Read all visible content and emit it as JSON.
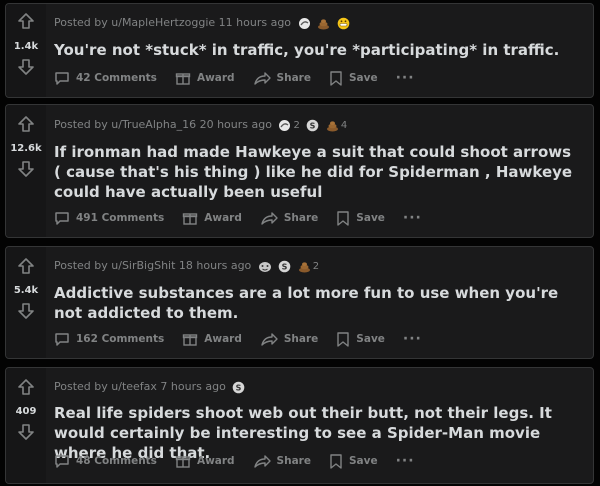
{
  "colors": {
    "background": "#030303",
    "card": "#1a1a1b",
    "card_border": "#343536",
    "text": "#d7dadc",
    "muted": "#818384"
  },
  "posts": [
    {
      "score": "1.4k",
      "posted_by_prefix": "Posted by ",
      "author": "u/MapleHertzoggie",
      "time": "11 hours ago",
      "awards": [
        {
          "icon": "rocket-like-award-icon",
          "count": ""
        },
        {
          "icon": "poop-award-icon",
          "count": ""
        },
        {
          "icon": "grinning-face-award-icon",
          "count": ""
        }
      ],
      "title": "You're not *stuck* in traffic, you're *participating* in traffic.",
      "comments_label": "42 Comments",
      "award_label": "Award",
      "share_label": "Share",
      "save_label": "Save",
      "more_label": "···"
    },
    {
      "score": "12.6k",
      "posted_by_prefix": "Posted by ",
      "author": "u/TrueAlpha_16",
      "time": "20 hours ago",
      "awards": [
        {
          "icon": "rocket-like-award-icon",
          "count": "2"
        },
        {
          "icon": "silver-award-icon",
          "count": ""
        },
        {
          "icon": "poop-award-icon",
          "count": "4"
        }
      ],
      "title": "If ironman had made Hawkeye a suit that could shoot arrows ( cause that's his thing ) like he did for Spiderman , Hawkeye could have actually been useful",
      "comments_label": "491 Comments",
      "award_label": "Award",
      "share_label": "Share",
      "save_label": "Save",
      "more_label": "···"
    },
    {
      "score": "5.4k",
      "posted_by_prefix": "Posted by ",
      "author": "u/SirBigShit",
      "time": "18 hours ago",
      "awards": [
        {
          "icon": "wholesome-award-icon",
          "count": ""
        },
        {
          "icon": "silver-award-icon",
          "count": ""
        },
        {
          "icon": "poop-award-icon",
          "count": "2"
        }
      ],
      "title": "Addictive substances are a lot more fun to use when you're not addicted to them.",
      "comments_label": "162 Comments",
      "award_label": "Award",
      "share_label": "Share",
      "save_label": "Save",
      "more_label": "···"
    },
    {
      "score": "409",
      "posted_by_prefix": "Posted by ",
      "author": "u/teefax",
      "time": "7 hours ago",
      "awards": [
        {
          "icon": "silver-award-icon",
          "count": ""
        }
      ],
      "title": "Real life spiders shoot web out their butt, not their legs. It would certainly be interesting to see a Spider-Man movie where he did that.",
      "comments_label": "48 Comments",
      "award_label": "Award",
      "share_label": "Share",
      "save_label": "Save",
      "more_label": "···"
    }
  ]
}
